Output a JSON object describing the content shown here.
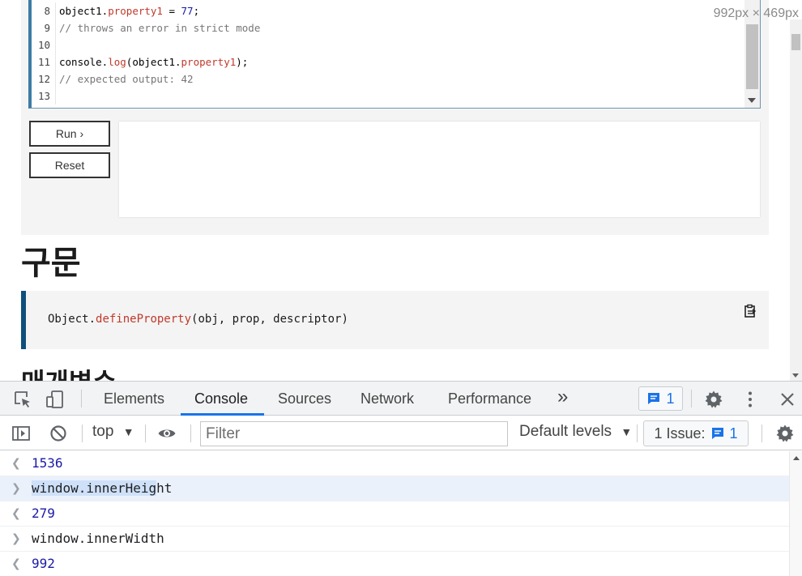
{
  "editor": {
    "lines": [
      {
        "num": "8",
        "parts": [
          {
            "t": "object1.",
            "c": ""
          },
          {
            "t": "property1",
            "c": "prop"
          },
          {
            "t": " = ",
            "c": ""
          },
          {
            "t": "77",
            "c": "num"
          },
          {
            "t": ";",
            "c": ""
          }
        ]
      },
      {
        "num": "9",
        "parts": [
          {
            "t": "// throws an error in strict mode",
            "c": "com"
          }
        ]
      },
      {
        "num": "10",
        "parts": []
      },
      {
        "num": "11",
        "parts": [
          {
            "t": "console.",
            "c": ""
          },
          {
            "t": "log",
            "c": "fn"
          },
          {
            "t": "(object1.",
            "c": ""
          },
          {
            "t": "property1",
            "c": "prop"
          },
          {
            "t": ");",
            "c": ""
          }
        ]
      },
      {
        "num": "12",
        "parts": [
          {
            "t": "// expected output: 42",
            "c": "com"
          }
        ]
      },
      {
        "num": "13",
        "parts": []
      }
    ]
  },
  "demo": {
    "run_label": "Run ›",
    "reset_label": "Reset"
  },
  "page": {
    "syntax_heading": "구문",
    "syntax_code_obj": "Object.",
    "syntax_code_fn": "defineProperty",
    "syntax_code_args": "(obj, prop, descriptor)",
    "params_heading": "매개변수",
    "size_tip": "992px × 469px"
  },
  "devtools": {
    "tabs": [
      {
        "label": "Elements",
        "name": "tab-elements"
      },
      {
        "label": "Console",
        "name": "tab-console"
      },
      {
        "label": "Sources",
        "name": "tab-sources"
      },
      {
        "label": "Network",
        "name": "tab-network"
      },
      {
        "label": "Performance",
        "name": "tab-performance"
      }
    ],
    "more_tabs": "»",
    "message_count": "1",
    "context": "top",
    "filter_placeholder": "Filter",
    "levels": "Default levels",
    "issues_label": "1 Issue:",
    "issues_count": "1"
  },
  "console": {
    "rows": [
      {
        "kind": "result",
        "text": "1536"
      },
      {
        "kind": "input",
        "text": "window.innerHeight",
        "selected": "window.innerHeig",
        "rest": "ht"
      },
      {
        "kind": "result",
        "text": "279"
      },
      {
        "kind": "input",
        "text": "window.innerWidth"
      },
      {
        "kind": "result",
        "text": "992"
      }
    ]
  },
  "colors": {
    "accent": "#1a73e8",
    "result_value": "#1a1aa6",
    "syntax_fn": "#c0392b",
    "syntax_border": "#0e4f7c"
  }
}
